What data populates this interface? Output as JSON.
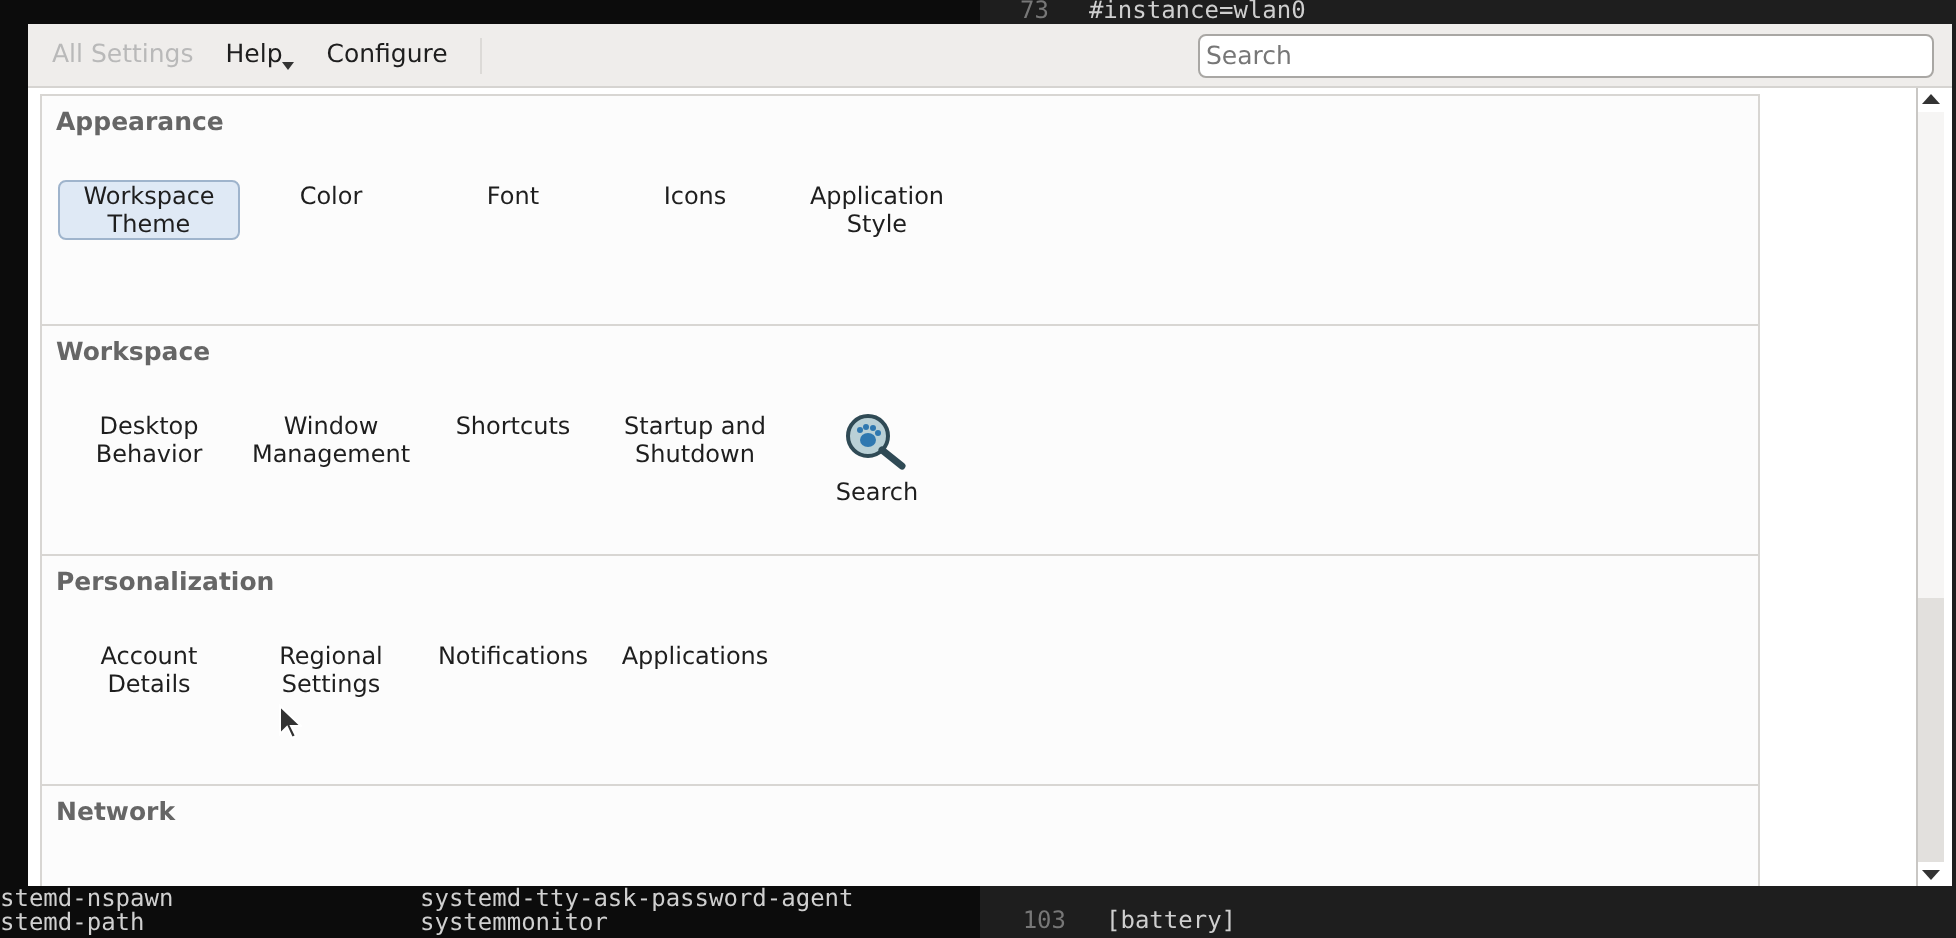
{
  "toolbar": {
    "items": [
      {
        "label": "All Settings",
        "disabled": true
      },
      {
        "label": "Help",
        "disabled": false,
        "menu": true
      },
      {
        "label": "Configure",
        "disabled": false
      }
    ],
    "search": {
      "placeholder": "Search"
    }
  },
  "sections": [
    {
      "title": "Appearance",
      "items": [
        {
          "label": "Workspace Theme",
          "kind": "text",
          "selected": true
        },
        {
          "label": "Color",
          "kind": "text",
          "selected": false
        },
        {
          "label": "Font",
          "kind": "text",
          "selected": false
        },
        {
          "label": "Icons",
          "kind": "text",
          "selected": false
        },
        {
          "label": "Application Style",
          "kind": "text",
          "selected": false
        }
      ]
    },
    {
      "title": "Workspace",
      "items": [
        {
          "label": "Desktop Behavior",
          "kind": "text",
          "selected": false
        },
        {
          "label": "Window Management",
          "kind": "text",
          "selected": false
        },
        {
          "label": "Shortcuts",
          "kind": "text",
          "selected": false
        },
        {
          "label": "Startup and Shutdown",
          "kind": "text",
          "selected": false
        },
        {
          "label": "Search",
          "kind": "icon",
          "selected": false
        }
      ]
    },
    {
      "title": "Personalization",
      "items": [
        {
          "label": "Account Details",
          "kind": "text",
          "selected": false
        },
        {
          "label": "Regional Settings",
          "kind": "text",
          "selected": false
        },
        {
          "label": "Notifications",
          "kind": "text",
          "selected": false
        },
        {
          "label": "Applications",
          "kind": "text",
          "selected": false
        }
      ]
    },
    {
      "title": "Network"
    }
  ],
  "terminal": {
    "lines": [
      [
        "stemd-nspawn",
        "systemd-tty-ask-password-agent"
      ],
      [
        "stemd-path",
        "systemmonitor"
      ]
    ]
  },
  "editor": {
    "top_line": {
      "number": "73",
      "text": "#instance=wlan0"
    },
    "bottom_lines": [
      {
        "number": "103",
        "text": "[battery]"
      }
    ]
  }
}
